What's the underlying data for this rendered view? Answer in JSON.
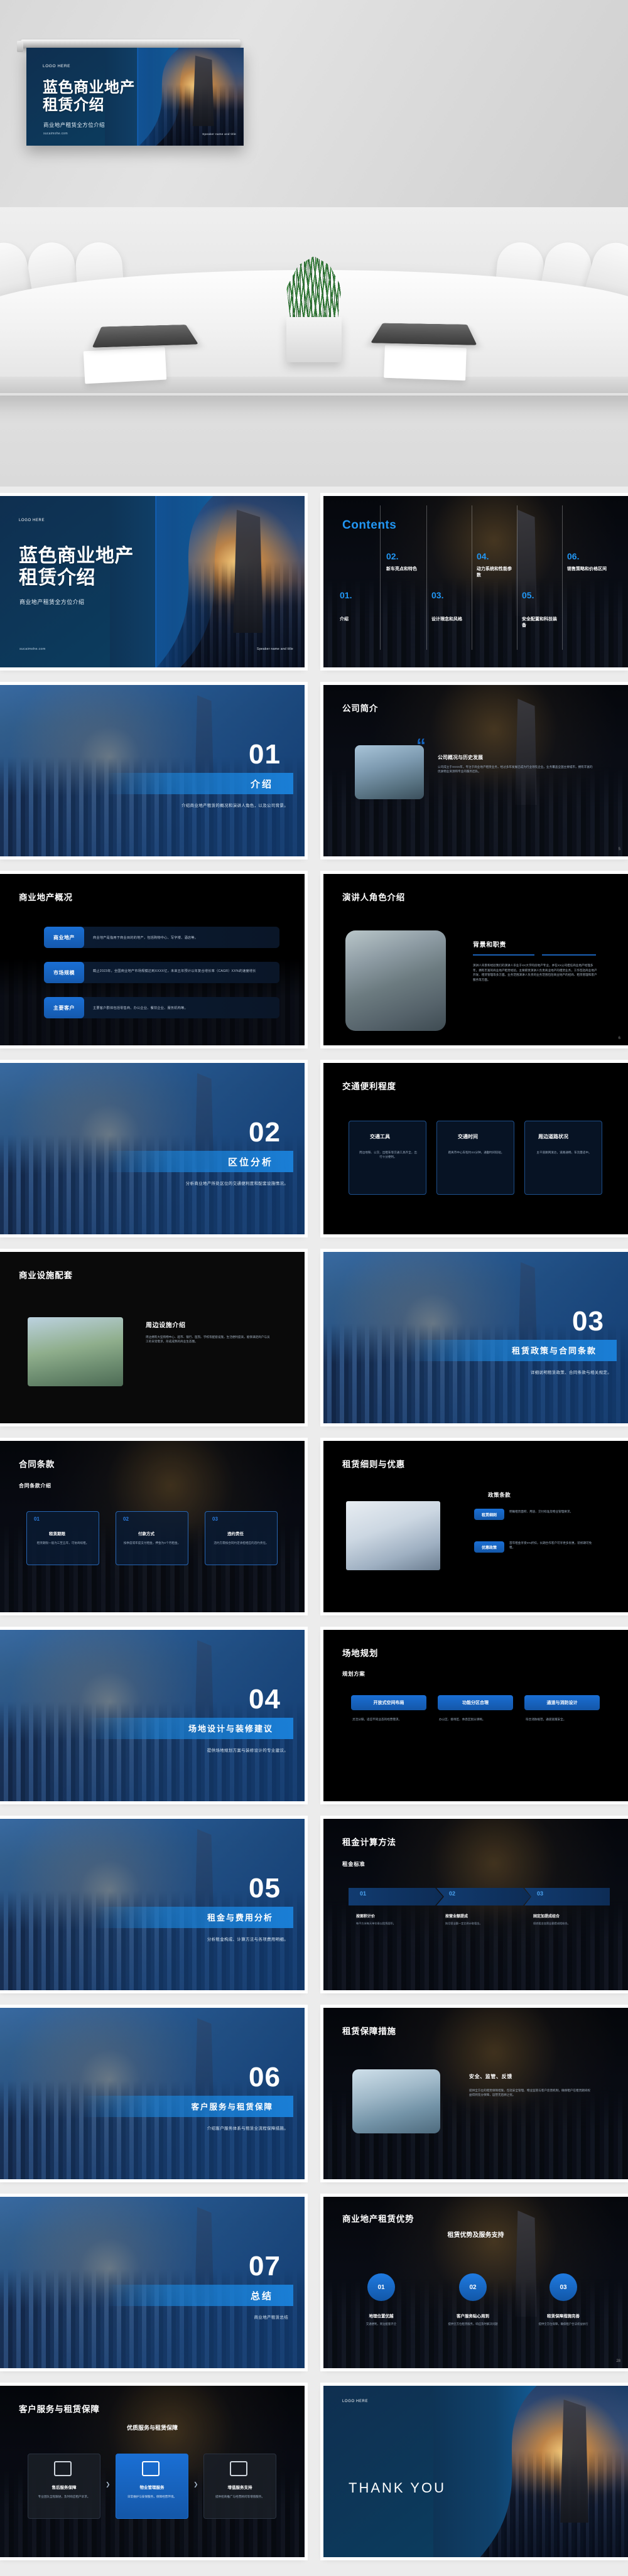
{
  "brand": {
    "accent_blue": "#1a6fd4",
    "dark_navy": "#0d3c5e",
    "slide_black": "#000000",
    "page_bg": "#ececec"
  },
  "hero_slide": {
    "logo": "LOGO HERE",
    "title_line1": "蓝色商业地产",
    "title_line2": "租赁介绍",
    "subtitle": "商业地产租赁全方位介绍",
    "website": "sucaimohe.com",
    "speaker": "Speaker name and title"
  },
  "slides": [
    {
      "id": 1,
      "kind": "cover",
      "logo": "LOGO HERE",
      "title_line1": "蓝色商业地产",
      "title_line2": "租赁介绍",
      "subtitle": "商业地产租赁全方位介绍",
      "website": "sucaimohe.com",
      "speaker": "Speaker name and title"
    },
    {
      "id": 2,
      "kind": "contents",
      "title": "Contents",
      "items": [
        {
          "num": "01.",
          "label": "介绍"
        },
        {
          "num": "02.",
          "label": "新车亮点和特色"
        },
        {
          "num": "03.",
          "label": "设计理念和风格"
        },
        {
          "num": "04.",
          "label": "动力系统和性能参数"
        },
        {
          "num": "05.",
          "label": "安全配置和科技装备"
        },
        {
          "num": "06.",
          "label": "销售策略和价格区间"
        }
      ]
    },
    {
      "id": 3,
      "kind": "section",
      "num": "01",
      "label": "介绍",
      "desc": "介绍商业地产租赁的概况和演讲人角色，以及公司背景。"
    },
    {
      "id": 4,
      "kind": "company",
      "title": "公司简介",
      "card_title": "公司概况与历史发展",
      "card_text": "公司成立于XXXX年，专注于商业地产租赁业务，经过多年发展已成为行业领先企业。业务覆盖全国主要城市，拥有丰富的优质物业资源和专业的服务团队。",
      "page": "5"
    },
    {
      "id": 5,
      "kind": "overview",
      "title": "商业地产概况",
      "rows": [
        {
          "tag": "商业地产",
          "text": "商业地产是指用于商业目的的地产，包括购物中心、写字楼、酒店等。"
        },
        {
          "tag": "市场规模",
          "text": "截止2023年，全国商业地产市场规模达到XXXX亿，未来五年预计以年复合增长率（CAGR）XX%的速度增长"
        },
        {
          "tag": "主要客户",
          "text": "主要客户群体包括零售商、办公企业、餐饮企业、服务机构等。"
        }
      ]
    },
    {
      "id": 6,
      "kind": "speaker",
      "title": "演讲人角色介绍",
      "sub": "背景和职责",
      "text": "演讲人背景和经验我们的演讲人毕业于XX大学的房地产专业，并在XX公司担任商业地产经理多年，拥有丰富的商业地产租赁经验。主要职责演讲人负责商业地产的租赁业务，工作包括商业地产开发、租赁管理等多方面。业务范围演讲人负责的业务范围包括商业地产的招商、租赁管理和客户服务等方面。",
      "page": "6"
    },
    {
      "id": 7,
      "kind": "section",
      "num": "02",
      "label": "区位分析",
      "desc": "分析商业地产所处区位的交通便利度和配套设施情况。"
    },
    {
      "id": 8,
      "kind": "three-card",
      "title": "交通便利程度",
      "cards": [
        {
          "head": "交通工具",
          "text": "周边地铁、公交、出租车等交通工具齐全，出行十分便利。"
        },
        {
          "head": "交通时间",
          "text": "距离市中心车程约XX分钟，通勤时间较短。"
        },
        {
          "head": "周边道路状况",
          "text": "主干道路网发达，道路通畅，车流量适中。"
        }
      ]
    },
    {
      "id": 9,
      "kind": "facility",
      "title": "商业设施配套",
      "sub": "周边设施介绍",
      "text": "周边拥有大型购物中心、超市、银行、医院、学校等配套设施，生活便利度高，能够满足商户与员工的日常需求，形成成熟的商业生态圈。"
    },
    {
      "id": 10,
      "kind": "section",
      "num": "03",
      "label": "租赁政策与合同条款",
      "desc": "详细说明租赁政策、合同条款与相关规定。"
    },
    {
      "id": 11,
      "kind": "terms",
      "title": "合同条款",
      "sub": "合同条款介绍",
      "items": [
        {
          "num": "01",
          "head": "租赁期限",
          "text": "租赁期限一般为三至五年，可协商续租。"
        },
        {
          "num": "02",
          "head": "付款方式",
          "text": "按季度或年度支付租金，押金为X个月租金。"
        },
        {
          "num": "03",
          "head": "违约责任",
          "text": "违约方需按合同约定承担相应的违约责任。"
        }
      ]
    },
    {
      "id": 12,
      "kind": "policy",
      "title": "租赁细则与优惠",
      "sub": "政策条款",
      "blocks": [
        {
          "head": "租赁细则",
          "text": "明确租赁面积、用途、交付标准及物业管理要求。"
        },
        {
          "head": "优惠政策",
          "text": "首年租金享受X%折扣，长期合作客户可享更多优惠，装修期可免租。"
        }
      ]
    },
    {
      "id": 13,
      "kind": "section",
      "num": "04",
      "label": "场地设计与装修建议",
      "desc": "提供场地规划方案与装修设计的专业建议。"
    },
    {
      "id": 14,
      "kind": "plan",
      "title": "场地规划",
      "sub": "规划方案",
      "cards": [
        {
          "head": "开放式空间布局",
          "text": "灵活分隔，适应不同业态的经营需求。"
        },
        {
          "head": "功能分区合理",
          "text": "办公区、接待区、休息区划分清晰。"
        },
        {
          "head": "通道与消防设计",
          "text": "符合消防规范，通道宽敞安全。"
        }
      ]
    },
    {
      "id": 15,
      "kind": "section",
      "num": "05",
      "label": "租金与费用分析",
      "desc": "分析租金构成、计算方法与各项费用明细。"
    },
    {
      "id": 16,
      "kind": "steps",
      "title": "租金计算方法",
      "sub": "租金标准",
      "steps": [
        {
          "num": "01",
          "head": "按面积计价",
          "text": "每平方米每天单价乘以租赁面积。"
        },
        {
          "num": "02",
          "head": "按营业额提成",
          "text": "按月营业额一定比例计取租金。"
        },
        {
          "num": "03",
          "head": "固定加提成组合",
          "text": "保底租金加营业额提成相结合。"
        }
      ]
    },
    {
      "id": 17,
      "kind": "section",
      "num": "06",
      "label": "客户服务与租赁保障",
      "desc": "介绍客户服务体系与租赁全流程保障措施。"
    },
    {
      "id": 18,
      "kind": "guarantee",
      "title": "租赁保障措施",
      "sub": "安全、监管、反馈",
      "text": "提供全方位的租赁保障措施，包括安全管理、物业监管与客户反馈机制，确保租户在租赁期间权益得到充分保障，运营无后顾之忧。"
    },
    {
      "id": 19,
      "kind": "section",
      "num": "07",
      "label": "总结",
      "desc": "商业地产租赁总结"
    },
    {
      "id": 20,
      "kind": "advantage",
      "title": "商业地产租赁优势",
      "sub": "租赁优势及服务支持",
      "items": [
        {
          "num": "01",
          "head": "地理位置优越",
          "text": "交通便利，周边配套齐全"
        },
        {
          "num": "02",
          "head": "客户服务贴心周到",
          "text": "提供全方位租赁服务，响应及时解决问题"
        },
        {
          "num": "03",
          "head": "租赁保障措施完善",
          "text": "提供全方位保障，确保租户合法权益执行"
        }
      ],
      "page": "28"
    },
    {
      "id": 21,
      "kind": "service",
      "title": "客户服务与租赁保障",
      "sub": "优质服务与租赁保障",
      "cards": [
        {
          "head": "售后服务保障",
          "text": "专业团队全程跟进，及时响应租户诉求。"
        },
        {
          "head": "物业管理服务",
          "text": "日常维护与安保服务，保障经营环境。"
        },
        {
          "head": "增值服务支持",
          "text": "提供招商推广与经营顾问等增值服务。"
        }
      ]
    },
    {
      "id": 22,
      "kind": "thanks",
      "logo": "LOGO HERE",
      "text": "THANK YOU"
    }
  ]
}
